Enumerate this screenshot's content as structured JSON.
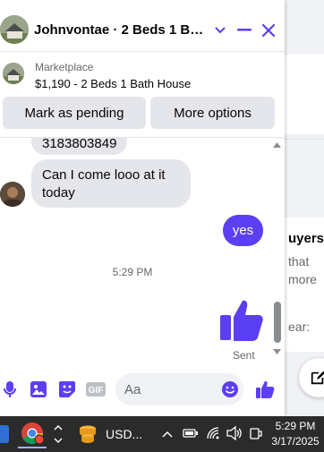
{
  "chat": {
    "title": "Johnvontae · 2 Beds 1 Bath…",
    "listing": {
      "label": "Marketplace",
      "title": "$1,190 - 2 Beds 1 Bath House"
    },
    "actions": {
      "pending": "Mark as pending",
      "more": "More options"
    },
    "messages": {
      "in_1": "3183803849",
      "in_2_line1": "Can I come looo at it",
      "in_2_line2": "today",
      "out_1": "yes",
      "time": "5:29 PM",
      "sent": "Sent"
    },
    "composer": {
      "placeholder": "Aa",
      "gif": "GIF"
    },
    "accent": "#5b3ff2"
  },
  "background_page": {
    "text_1": "uyers",
    "text_2": "that",
    "text_3": "more",
    "text_4": "ear:"
  },
  "taskbar": {
    "app_label": "USD...",
    "time": "5:29 PM",
    "date": "3/17/2025"
  }
}
